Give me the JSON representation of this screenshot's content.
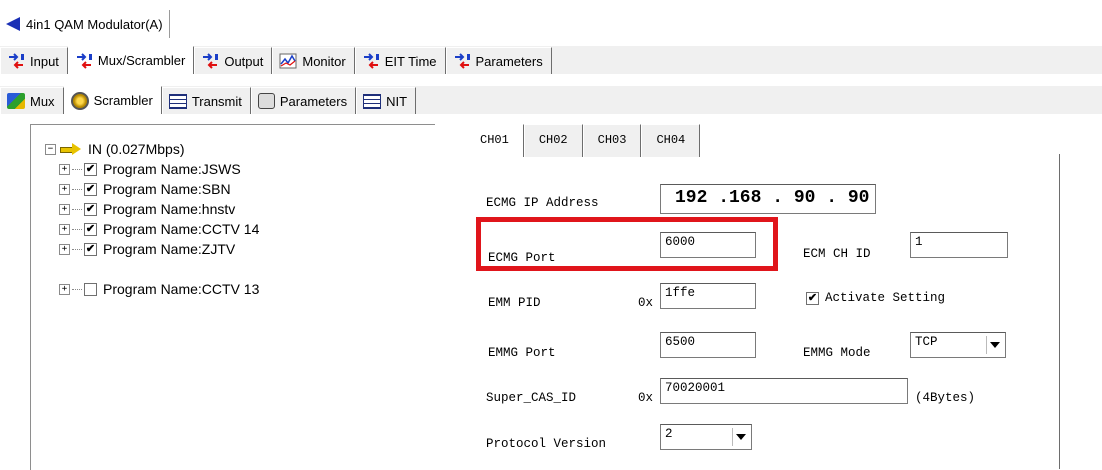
{
  "window": {
    "title": "4in1 QAM Modulator(A)"
  },
  "top_tabs": [
    {
      "label": "Input"
    },
    {
      "label": "Mux/Scrambler"
    },
    {
      "label": "Output"
    },
    {
      "label": "Monitor"
    },
    {
      "label": "EIT Time"
    },
    {
      "label": "Parameters"
    }
  ],
  "sub_tabs": [
    {
      "label": "Mux"
    },
    {
      "label": "Scrambler"
    },
    {
      "label": "Transmit"
    },
    {
      "label": "Parameters"
    },
    {
      "label": "NIT"
    }
  ],
  "tree": {
    "root": "IN (0.027Mbps)",
    "items": [
      {
        "label": "Program Name:JSWS",
        "checked": true
      },
      {
        "label": "Program Name:SBN",
        "checked": true
      },
      {
        "label": "Program Name:hnstv",
        "checked": true
      },
      {
        "label": "Program Name:CCTV 14",
        "checked": true
      },
      {
        "label": "Program Name:ZJTV",
        "checked": true
      },
      {
        "label": "Program Name:CCTV 13",
        "checked": false
      }
    ],
    "expand_symbol": "+",
    "collapse_symbol": "−",
    "check_mark": "✔"
  },
  "channel_tabs": [
    "CH01",
    "CH02",
    "CH03",
    "CH04"
  ],
  "form": {
    "ecmg_ip_label": "ECMG IP Address",
    "ecmg_ip_value": "192 .168 . 90 . 90",
    "ecmg_port_label": "ECMG Port",
    "ecmg_port_value": "6000",
    "ecm_ch_id_label": "ECM CH ID",
    "ecm_ch_id_value": "1",
    "emm_pid_label": "EMM PID",
    "emm_pid_prefix": "0x",
    "emm_pid_value": "1ffe",
    "activate_label": "Activate Setting",
    "activate_checked": true,
    "emmg_port_label": "EMMG Port",
    "emmg_port_value": "6500",
    "emmg_mode_label": "EMMG Mode",
    "emmg_mode_value": "TCP",
    "super_cas_label": "Super_CAS_ID",
    "super_cas_prefix": "0x",
    "super_cas_value": "70020001",
    "super_cas_suffix": "(4Bytes)",
    "protocol_label": "Protocol Version",
    "protocol_value": "2"
  },
  "colors": {
    "highlight": "#e0151b",
    "back_arrow": "#1a2fb5",
    "tab_bg": "#f0f0f0"
  }
}
